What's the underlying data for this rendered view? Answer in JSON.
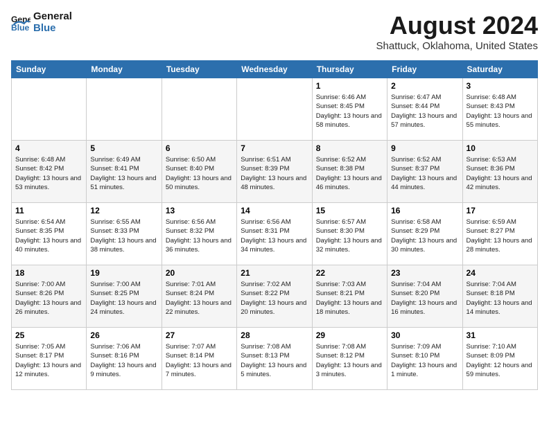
{
  "logo": {
    "line1": "General",
    "line2": "Blue"
  },
  "title": "August 2024",
  "subtitle": "Shattuck, Oklahoma, United States",
  "days_header": [
    "Sunday",
    "Monday",
    "Tuesday",
    "Wednesday",
    "Thursday",
    "Friday",
    "Saturday"
  ],
  "weeks": [
    [
      {
        "day": "",
        "sunrise": "",
        "sunset": "",
        "daylight": ""
      },
      {
        "day": "",
        "sunrise": "",
        "sunset": "",
        "daylight": ""
      },
      {
        "day": "",
        "sunrise": "",
        "sunset": "",
        "daylight": ""
      },
      {
        "day": "",
        "sunrise": "",
        "sunset": "",
        "daylight": ""
      },
      {
        "day": "1",
        "sunrise": "Sunrise: 6:46 AM",
        "sunset": "Sunset: 8:45 PM",
        "daylight": "Daylight: 13 hours and 58 minutes."
      },
      {
        "day": "2",
        "sunrise": "Sunrise: 6:47 AM",
        "sunset": "Sunset: 8:44 PM",
        "daylight": "Daylight: 13 hours and 57 minutes."
      },
      {
        "day": "3",
        "sunrise": "Sunrise: 6:48 AM",
        "sunset": "Sunset: 8:43 PM",
        "daylight": "Daylight: 13 hours and 55 minutes."
      }
    ],
    [
      {
        "day": "4",
        "sunrise": "Sunrise: 6:48 AM",
        "sunset": "Sunset: 8:42 PM",
        "daylight": "Daylight: 13 hours and 53 minutes."
      },
      {
        "day": "5",
        "sunrise": "Sunrise: 6:49 AM",
        "sunset": "Sunset: 8:41 PM",
        "daylight": "Daylight: 13 hours and 51 minutes."
      },
      {
        "day": "6",
        "sunrise": "Sunrise: 6:50 AM",
        "sunset": "Sunset: 8:40 PM",
        "daylight": "Daylight: 13 hours and 50 minutes."
      },
      {
        "day": "7",
        "sunrise": "Sunrise: 6:51 AM",
        "sunset": "Sunset: 8:39 PM",
        "daylight": "Daylight: 13 hours and 48 minutes."
      },
      {
        "day": "8",
        "sunrise": "Sunrise: 6:52 AM",
        "sunset": "Sunset: 8:38 PM",
        "daylight": "Daylight: 13 hours and 46 minutes."
      },
      {
        "day": "9",
        "sunrise": "Sunrise: 6:52 AM",
        "sunset": "Sunset: 8:37 PM",
        "daylight": "Daylight: 13 hours and 44 minutes."
      },
      {
        "day": "10",
        "sunrise": "Sunrise: 6:53 AM",
        "sunset": "Sunset: 8:36 PM",
        "daylight": "Daylight: 13 hours and 42 minutes."
      }
    ],
    [
      {
        "day": "11",
        "sunrise": "Sunrise: 6:54 AM",
        "sunset": "Sunset: 8:35 PM",
        "daylight": "Daylight: 13 hours and 40 minutes."
      },
      {
        "day": "12",
        "sunrise": "Sunrise: 6:55 AM",
        "sunset": "Sunset: 8:33 PM",
        "daylight": "Daylight: 13 hours and 38 minutes."
      },
      {
        "day": "13",
        "sunrise": "Sunrise: 6:56 AM",
        "sunset": "Sunset: 8:32 PM",
        "daylight": "Daylight: 13 hours and 36 minutes."
      },
      {
        "day": "14",
        "sunrise": "Sunrise: 6:56 AM",
        "sunset": "Sunset: 8:31 PM",
        "daylight": "Daylight: 13 hours and 34 minutes."
      },
      {
        "day": "15",
        "sunrise": "Sunrise: 6:57 AM",
        "sunset": "Sunset: 8:30 PM",
        "daylight": "Daylight: 13 hours and 32 minutes."
      },
      {
        "day": "16",
        "sunrise": "Sunrise: 6:58 AM",
        "sunset": "Sunset: 8:29 PM",
        "daylight": "Daylight: 13 hours and 30 minutes."
      },
      {
        "day": "17",
        "sunrise": "Sunrise: 6:59 AM",
        "sunset": "Sunset: 8:27 PM",
        "daylight": "Daylight: 13 hours and 28 minutes."
      }
    ],
    [
      {
        "day": "18",
        "sunrise": "Sunrise: 7:00 AM",
        "sunset": "Sunset: 8:26 PM",
        "daylight": "Daylight: 13 hours and 26 minutes."
      },
      {
        "day": "19",
        "sunrise": "Sunrise: 7:00 AM",
        "sunset": "Sunset: 8:25 PM",
        "daylight": "Daylight: 13 hours and 24 minutes."
      },
      {
        "day": "20",
        "sunrise": "Sunrise: 7:01 AM",
        "sunset": "Sunset: 8:24 PM",
        "daylight": "Daylight: 13 hours and 22 minutes."
      },
      {
        "day": "21",
        "sunrise": "Sunrise: 7:02 AM",
        "sunset": "Sunset: 8:22 PM",
        "daylight": "Daylight: 13 hours and 20 minutes."
      },
      {
        "day": "22",
        "sunrise": "Sunrise: 7:03 AM",
        "sunset": "Sunset: 8:21 PM",
        "daylight": "Daylight: 13 hours and 18 minutes."
      },
      {
        "day": "23",
        "sunrise": "Sunrise: 7:04 AM",
        "sunset": "Sunset: 8:20 PM",
        "daylight": "Daylight: 13 hours and 16 minutes."
      },
      {
        "day": "24",
        "sunrise": "Sunrise: 7:04 AM",
        "sunset": "Sunset: 8:18 PM",
        "daylight": "Daylight: 13 hours and 14 minutes."
      }
    ],
    [
      {
        "day": "25",
        "sunrise": "Sunrise: 7:05 AM",
        "sunset": "Sunset: 8:17 PM",
        "daylight": "Daylight: 13 hours and 12 minutes."
      },
      {
        "day": "26",
        "sunrise": "Sunrise: 7:06 AM",
        "sunset": "Sunset: 8:16 PM",
        "daylight": "Daylight: 13 hours and 9 minutes."
      },
      {
        "day": "27",
        "sunrise": "Sunrise: 7:07 AM",
        "sunset": "Sunset: 8:14 PM",
        "daylight": "Daylight: 13 hours and 7 minutes."
      },
      {
        "day": "28",
        "sunrise": "Sunrise: 7:08 AM",
        "sunset": "Sunset: 8:13 PM",
        "daylight": "Daylight: 13 hours and 5 minutes."
      },
      {
        "day": "29",
        "sunrise": "Sunrise: 7:08 AM",
        "sunset": "Sunset: 8:12 PM",
        "daylight": "Daylight: 13 hours and 3 minutes."
      },
      {
        "day": "30",
        "sunrise": "Sunrise: 7:09 AM",
        "sunset": "Sunset: 8:10 PM",
        "daylight": "Daylight: 13 hours and 1 minute."
      },
      {
        "day": "31",
        "sunrise": "Sunrise: 7:10 AM",
        "sunset": "Sunset: 8:09 PM",
        "daylight": "Daylight: 12 hours and 59 minutes."
      }
    ]
  ]
}
